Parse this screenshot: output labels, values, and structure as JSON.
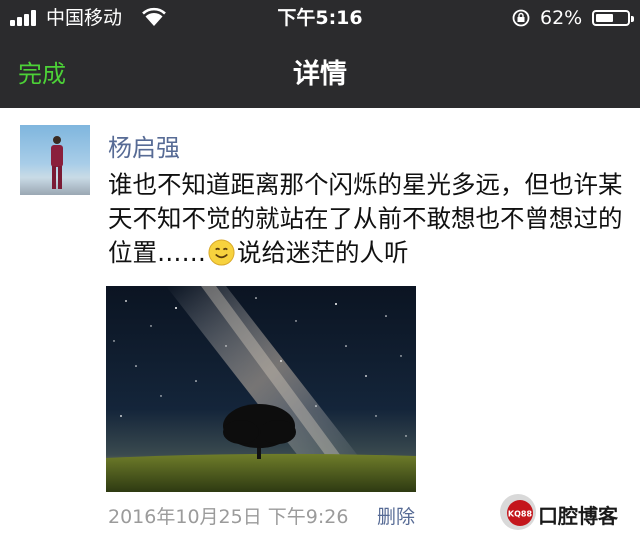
{
  "status_bar": {
    "carrier": "中国移动",
    "time": "下午5:16",
    "battery_percent": "62%",
    "battery_level": 0.62
  },
  "nav": {
    "done_label": "完成",
    "title": "详情"
  },
  "post": {
    "author": "杨启强",
    "text_part1": "谁也不知道距离那个闪烁的星光多远，但也许某天不知不觉的就站在了从前不敢想也不曾想过的位置……",
    "text_part2": "说给迷茫的人听",
    "timestamp": "2016年10月25日 下午9:26",
    "delete_label": "删除"
  },
  "watermark": {
    "badge": "KQ88",
    "text": "口腔博客"
  },
  "colors": {
    "topbar": "#2b2b2d",
    "done_green": "#4cd137",
    "link_blue": "#576b95",
    "meta_gray": "#9b9b9b"
  },
  "icons": [
    "signal-icon",
    "wifi-icon",
    "rotation-lock-icon",
    "battery-icon",
    "smile-emoji-icon"
  ]
}
